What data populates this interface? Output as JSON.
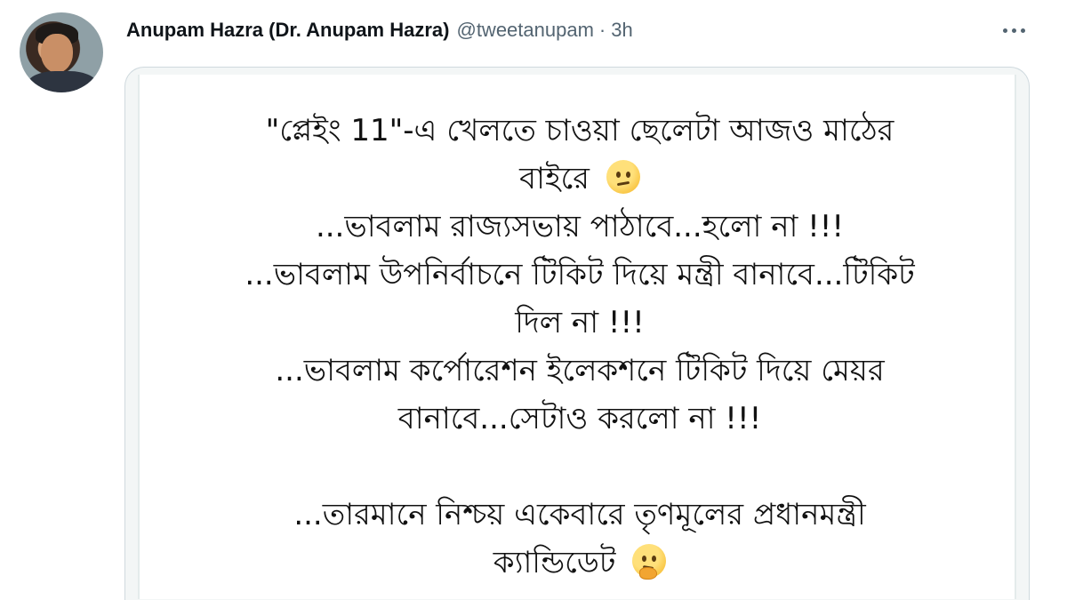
{
  "tweet": {
    "display_name": "Anupam Hazra (Dr. Anupam Hazra)",
    "handle": "@tweetanupam",
    "separator": "·",
    "time": "3h"
  },
  "icons": {
    "more": "more-horizontal-icon",
    "emoji_confused": "confused-face-emoji",
    "emoji_thinking": "thinking-face-emoji"
  },
  "image_text": {
    "line1": "\"প্লেইং 11\"-এ খেলতে চাওয়া ছেলেটা আজও মাঠের",
    "line2": "বাইরে",
    "line3": "...ভাবলাম রাজ্যসভায় পাঠাবে...হলো না !!!",
    "line4": "...ভাবলাম উপনির্বাচনে টিকিট দিয়ে মন্ত্রী বানাবে...টিকিট",
    "line5": "দিল না !!!",
    "line6": "...ভাবলাম কর্পোরেশন ইলেকশনে টিকিট দিয়ে মেয়র",
    "line7": "বানাবে...সেটাও করলো না !!!",
    "line8": "...তারমানে নিশ্চয় একেবারে তৃণমূলের প্রধানমন্ত্রী",
    "line9": "ক্যান্ডিডেট"
  }
}
